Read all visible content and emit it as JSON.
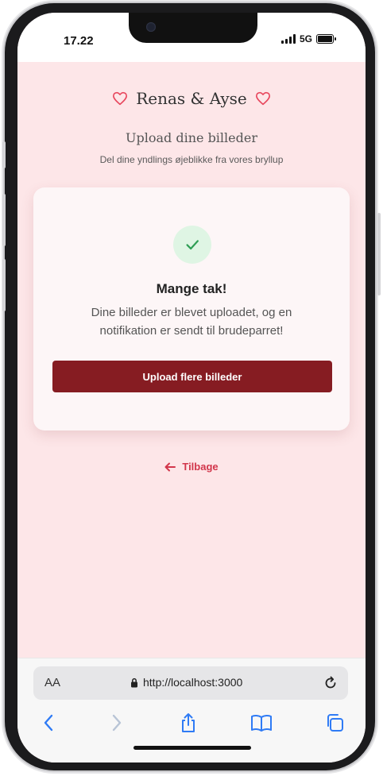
{
  "status_bar": {
    "time": "17.22",
    "network": "5G"
  },
  "header": {
    "brand": "Renas & Ayse",
    "title": "Upload dine billeder",
    "subtitle": "Del dine yndlings øjeblikke fra vores bryllup"
  },
  "success_card": {
    "icon": "check-icon",
    "title": "Mange tak!",
    "message": "Dine billeder er blevet uploadet, og en notifikation er sendt til brudeparret!",
    "button_label": "Upload flere billeder"
  },
  "back_link": {
    "label": "Tilbage"
  },
  "browser": {
    "text_size_label": "AA",
    "url": "http://localhost:3000"
  },
  "colors": {
    "page_background": "#fde6e8",
    "primary_button": "#861c22",
    "accent_pink": "#d2364b",
    "success_green": "#2f9e55"
  }
}
